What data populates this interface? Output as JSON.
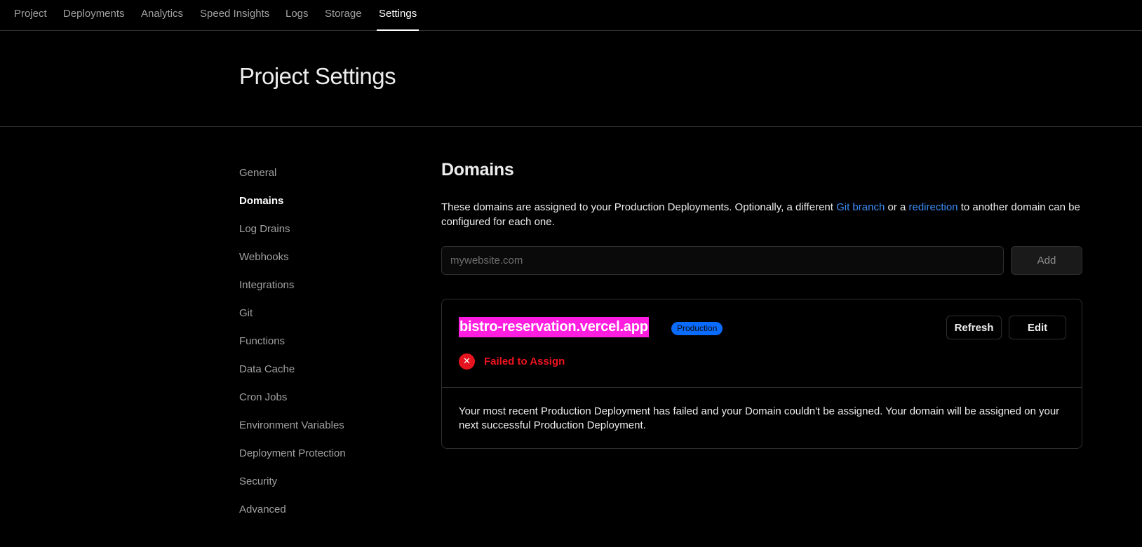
{
  "nav": {
    "tabs": [
      {
        "label": "Project"
      },
      {
        "label": "Deployments"
      },
      {
        "label": "Analytics"
      },
      {
        "label": "Speed Insights"
      },
      {
        "label": "Logs"
      },
      {
        "label": "Storage"
      },
      {
        "label": "Settings",
        "active": true
      }
    ]
  },
  "header": {
    "title": "Project Settings"
  },
  "sidebar": {
    "items": [
      {
        "label": "General"
      },
      {
        "label": "Domains",
        "active": true
      },
      {
        "label": "Log Drains"
      },
      {
        "label": "Webhooks"
      },
      {
        "label": "Integrations"
      },
      {
        "label": "Git"
      },
      {
        "label": "Functions"
      },
      {
        "label": "Data Cache"
      },
      {
        "label": "Cron Jobs"
      },
      {
        "label": "Environment Variables"
      },
      {
        "label": "Deployment Protection"
      },
      {
        "label": "Security"
      },
      {
        "label": "Advanced"
      }
    ]
  },
  "domains": {
    "title": "Domains",
    "description": {
      "part1": "These domains are assigned to your Production Deployments. Optionally, a different ",
      "link1": "Git branch",
      "part2": " or a ",
      "link2": "redirection",
      "part3": " to another domain can be configured for each one."
    },
    "input": {
      "placeholder": "mywebsite.com",
      "value": ""
    },
    "add_label": "Add",
    "card": {
      "domain": "bistro-reservation.vercel.app",
      "environment": "Production",
      "refresh_label": "Refresh",
      "edit_label": "Edit",
      "status": "Failed to Assign",
      "status_icon": "x-circle-icon",
      "message": "Your most recent Production Deployment has failed and your Domain couldn't be assigned. Your domain will be assigned on your next successful Production Deployment."
    }
  },
  "colors": {
    "background": "#000000",
    "link": "#3b8df5",
    "error": "#e5141f",
    "highlight": "#ff1ee0",
    "badge": "#0a6cff"
  }
}
